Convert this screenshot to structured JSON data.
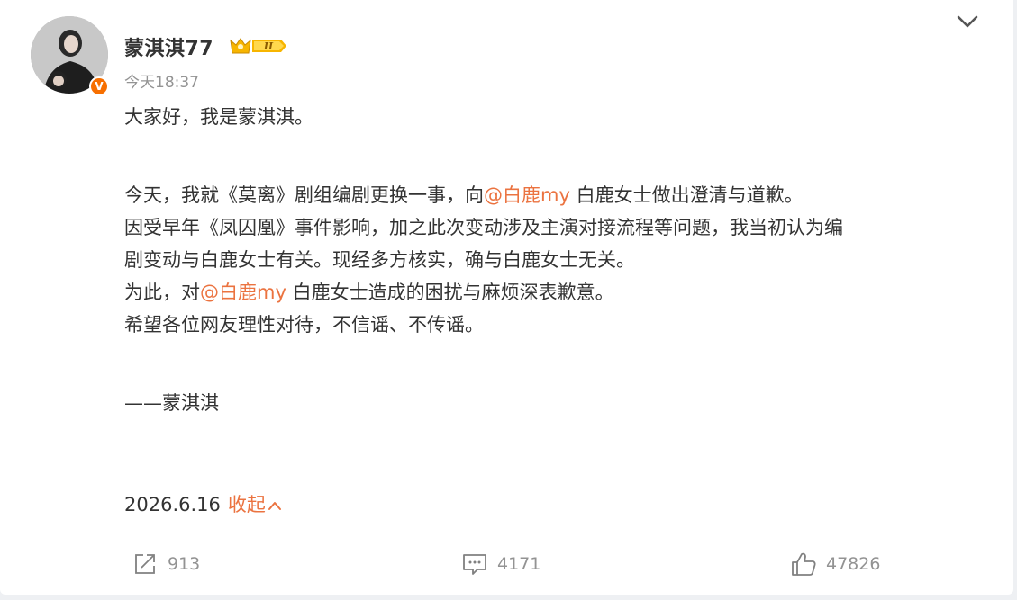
{
  "post": {
    "author": {
      "username": "蒙淇淇77",
      "verified_badge": "V",
      "vip_badge_text": "II",
      "vip_badge_color": "#f7b500"
    },
    "time": "今天18:37",
    "content": {
      "line1": "大家好，我是蒙淇淇。",
      "para2_pre": "今天，我就《莫离》剧组编剧更换一事，向",
      "mention1": "@白鹿my",
      "para2_post": " 白鹿女士做出澄清与道歉。",
      "para3_line1": "因受早年《凤囚凰》事件影响，加之此次变动涉及主演对接流程等问题，我当初认为编",
      "para3_line2": "剧变动与白鹿女士有关。现经多方核实，确与白鹿女士无关。",
      "para4_pre": "为此，对",
      "mention2": "@白鹿my",
      "para4_post": " 白鹿女士造成的困扰与麻烦深表歉意。",
      "para5": "希望各位网友理性对待，不信谣、不传谣。",
      "signature": "——蒙淇淇"
    },
    "date": "2026.6.16",
    "collapse_label": "收起",
    "accent_color": "#eb7340",
    "actions": {
      "repost_icon": "share-icon",
      "repost_count": "913",
      "comment_icon": "comment-icon",
      "comment_count": "4171",
      "like_icon": "thumbs-up-icon",
      "like_count": "47826"
    },
    "menu_icon": "chevron-down-icon"
  }
}
